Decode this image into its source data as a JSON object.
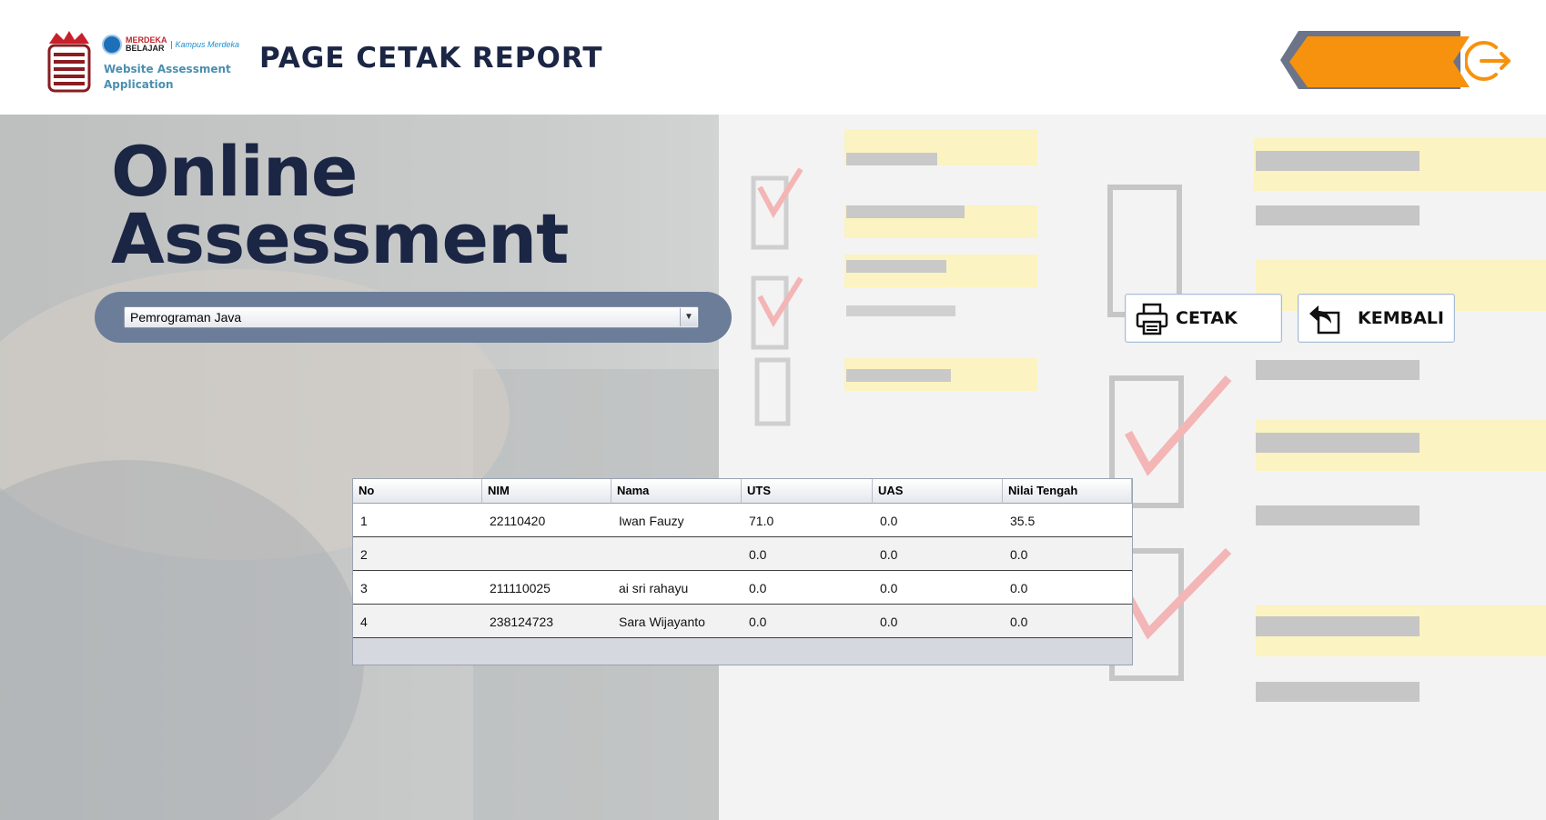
{
  "header": {
    "app_name": "Website Assessment Application",
    "page_title": "PAGE CETAK REPORT",
    "badge_merdeka_top": "MERDEKA",
    "badge_merdeka_bottom": "BELAJAR",
    "badge_kampus": "Kampus Merdeka",
    "logout_icon": "logout-arrow-icon",
    "logout_color": "#f7920f"
  },
  "hero": {
    "line1": "Online",
    "line2": "Assessment"
  },
  "course_select": {
    "selected": "Pemrograman Java"
  },
  "actions": {
    "print_label": "CETAK",
    "back_label": "KEMBALI"
  },
  "table": {
    "columns": [
      "No",
      "NIM",
      "Nama",
      "UTS",
      "UAS",
      "Nilai Tengah"
    ],
    "rows": [
      [
        "1",
        "22110420",
        "Iwan Fauzy",
        "71.0",
        "0.0",
        "35.5"
      ],
      [
        "2",
        "",
        "",
        "0.0",
        "0.0",
        "0.0"
      ],
      [
        "3",
        "211110025",
        "ai sri rahayu",
        "0.0",
        "0.0",
        "0.0"
      ],
      [
        "4",
        "238124723",
        "Sara Wijayanto",
        "0.0",
        "0.0",
        "0.0"
      ]
    ]
  },
  "colors": {
    "title_navy": "#1b2544",
    "accent_orange": "#f7920f",
    "select_bar": "#6c7d99"
  }
}
